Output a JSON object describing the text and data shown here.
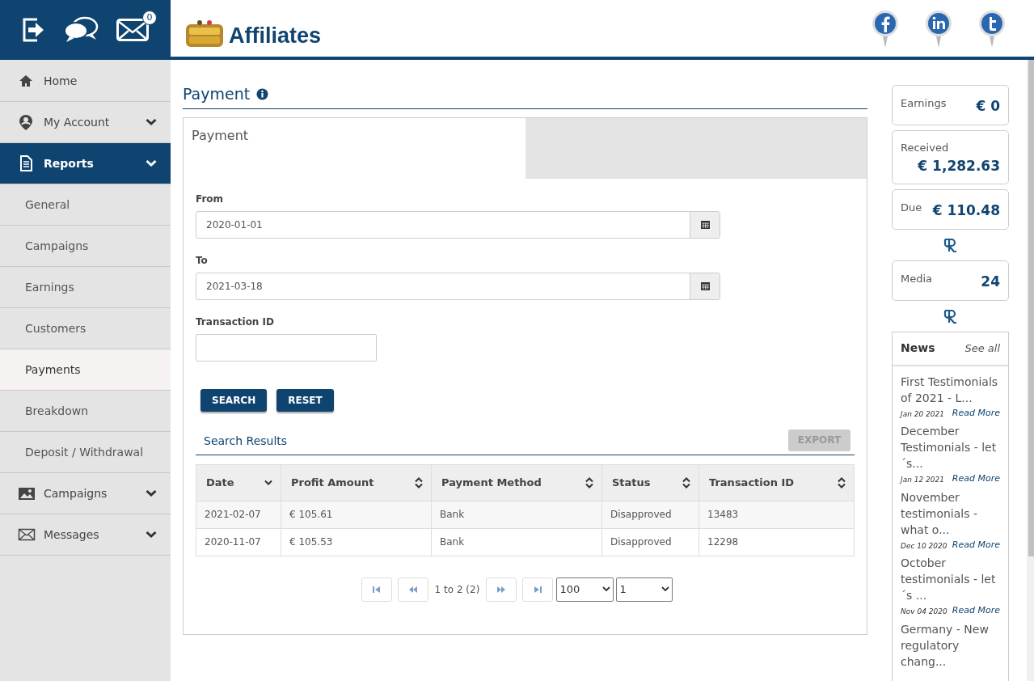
{
  "header": {
    "mail_count": "0",
    "brand": "Affiliates"
  },
  "sidebar": {
    "items": [
      {
        "label": "Home",
        "kind": "main",
        "selected": false,
        "expandable": false
      },
      {
        "label": "My Account",
        "kind": "main",
        "selected": false,
        "expandable": true
      },
      {
        "label": "Reports",
        "kind": "main",
        "selected": true,
        "expandable": true
      },
      {
        "label": "General",
        "kind": "sub",
        "selected": false
      },
      {
        "label": "Campaigns",
        "kind": "sub",
        "selected": false
      },
      {
        "label": "Earnings",
        "kind": "sub",
        "selected": false
      },
      {
        "label": "Customers",
        "kind": "sub",
        "selected": false
      },
      {
        "label": "Payments",
        "kind": "sub",
        "selected": true
      },
      {
        "label": "Breakdown",
        "kind": "sub",
        "selected": false
      },
      {
        "label": "Deposit / Withdrawal",
        "kind": "sub",
        "selected": false
      },
      {
        "label": "Campaigns",
        "kind": "main",
        "selected": false,
        "expandable": true
      },
      {
        "label": "Messages",
        "kind": "main",
        "selected": false,
        "expandable": true
      }
    ]
  },
  "page": {
    "title": "Payment",
    "tab": "Payment",
    "fields": [
      {
        "label": "From",
        "value": "2020-01-01",
        "kind": "date"
      },
      {
        "label": "To",
        "value": "2021-03-18",
        "kind": "date"
      },
      {
        "label": "Transaction ID",
        "kind": "text"
      }
    ],
    "buttons": [
      "SEARCH",
      "RESET"
    ],
    "results_title": "Search Results",
    "export": {
      "label": "EXPORT",
      "disabled": true
    },
    "table": {
      "columns": [
        {
          "label": "Date",
          "kind": "sorted"
        },
        {
          "label": "Profit Amount",
          "kind": "sortable"
        },
        {
          "label": "Payment Method",
          "kind": "sortable"
        },
        {
          "label": "Status",
          "kind": "sortable"
        },
        {
          "label": "Transaction ID",
          "kind": "sortable"
        }
      ],
      "rows": [
        [
          "2021-02-07",
          "€ 105.61",
          "Bank",
          "Disapproved",
          "13483"
        ],
        [
          "2020-11-07",
          "€ 105.53",
          "Bank",
          "Disapproved",
          "12298"
        ]
      ]
    },
    "pager": {
      "info": "1 to 2 (2)",
      "page_size": "100",
      "page": "1"
    }
  },
  "stats": [
    {
      "label": "Earnings",
      "value": "€ 0",
      "kind": "inline"
    },
    {
      "label": "Received",
      "value": "€ 1,282.63",
      "kind": "stacked"
    },
    {
      "label": "Due",
      "value": "€ 110.48",
      "kind": "inline"
    },
    {
      "label": "Media",
      "value": "24",
      "kind": "inline"
    }
  ],
  "news": {
    "title": "News",
    "see_all": "See all",
    "items": [
      {
        "title": "First Testimonials of 2021 - L...",
        "date": "Jan 20 2021",
        "link": "Read More"
      },
      {
        "title": "December Testimonials - let ´s...",
        "date": "Jan 12 2021",
        "link": "Read More"
      },
      {
        "title": "November testimonials - what o...",
        "date": "Dec 10 2020",
        "link": "Read More"
      },
      {
        "title": "October testimonials - let´s ...",
        "date": "Nov 04 2020",
        "link": "Read More"
      },
      {
        "title": "Germany - New regulatory chang..."
      }
    ]
  }
}
